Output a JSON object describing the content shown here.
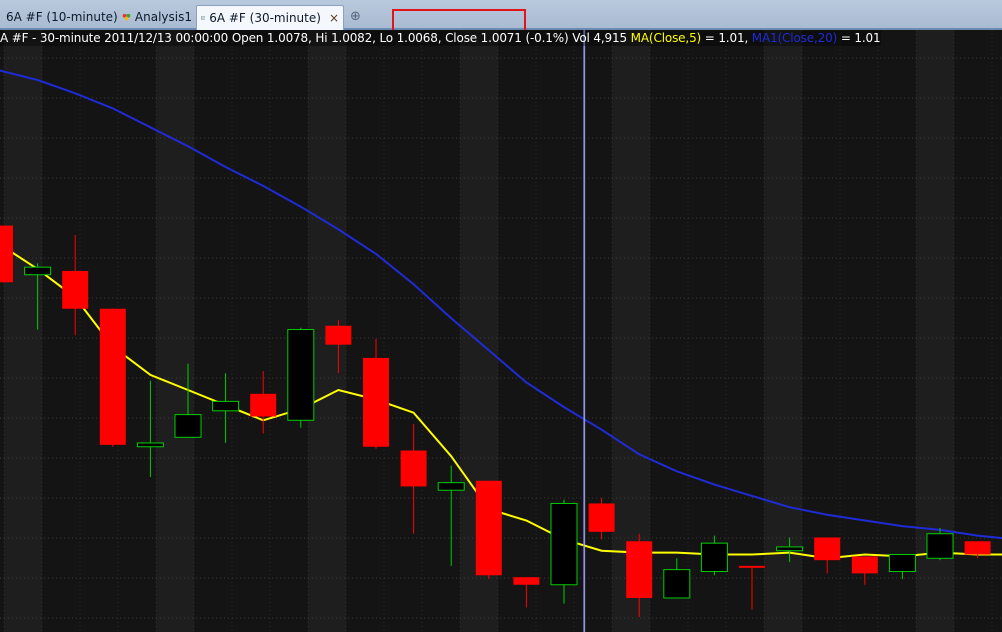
{
  "tabs": [
    {
      "label": "6A #F (10-minute)",
      "icon": "chart-icon",
      "active": false
    },
    {
      "label": "Analysis1",
      "icon": "analysis-icon",
      "active": false
    },
    {
      "label": "6A #F (30-minute)",
      "icon": "chart-icon",
      "active": true
    }
  ],
  "tab_close_symbol": "×",
  "new_tab_symbol": "⊕",
  "info": {
    "prefix": "A #F - 30-minute 2011/12/13 00:00:00 Open 1.0078, Hi 1.0082, Lo 1.0068, Close 1.0071 (-0.1%) Vol 4,915 ",
    "ma5_label": "MA(Close,5)",
    "ma5_value": " = 1.01, ",
    "ma20_label": "MA1(Close,20)",
    "ma20_value": " = 1.01"
  },
  "colors": {
    "up_candle": "#00cc00",
    "down_candle": "#ff0000",
    "ma5": "#ffff00",
    "ma20": "#1f2bd6",
    "crosshair": "#7b7bff",
    "highlight": "#e0161a"
  },
  "chart_data": {
    "type": "candlestick",
    "symbol": "6A #F",
    "interval": "30-minute",
    "candles": [
      {
        "o": 1.015,
        "h": 1.015,
        "l": 1.012,
        "c": 1.012,
        "dir": "down"
      },
      {
        "o": 1.0128,
        "h": 1.013,
        "l": 1.0095,
        "c": 1.0124,
        "dir": "up"
      },
      {
        "o": 1.0126,
        "h": 1.0145,
        "l": 1.0092,
        "c": 1.0106,
        "dir": "down"
      },
      {
        "o": 1.0106,
        "h": 1.0106,
        "l": 1.0033,
        "c": 1.0034,
        "dir": "down"
      },
      {
        "o": 1.0033,
        "h": 1.0068,
        "l": 1.0017,
        "c": 1.0035,
        "dir": "up"
      },
      {
        "o": 1.0038,
        "h": 1.0077,
        "l": 1.0038,
        "c": 1.005,
        "dir": "up"
      },
      {
        "o": 1.0052,
        "h": 1.0072,
        "l": 1.0035,
        "c": 1.0057,
        "dir": "up"
      },
      {
        "o": 1.0061,
        "h": 1.0073,
        "l": 1.004,
        "c": 1.0049,
        "dir": "down"
      },
      {
        "o": 1.0047,
        "h": 1.0096,
        "l": 1.0043,
        "c": 1.0095,
        "dir": "up"
      },
      {
        "o": 1.0097,
        "h": 1.01,
        "l": 1.0072,
        "c": 1.0087,
        "dir": "down"
      },
      {
        "o": 1.008,
        "h": 1.009,
        "l": 1.0032,
        "c": 1.0033,
        "dir": "down"
      },
      {
        "o": 1.0031,
        "h": 1.0045,
        "l": 0.9987,
        "c": 1.0012,
        "dir": "down"
      },
      {
        "o": 1.001,
        "h": 1.0023,
        "l": 0.997,
        "c": 1.0014,
        "dir": "up"
      },
      {
        "o": 1.0015,
        "h": 1.0015,
        "l": 0.9963,
        "c": 0.9965,
        "dir": "down"
      },
      {
        "o": 0.9964,
        "h": 0.9964,
        "l": 0.9948,
        "c": 0.996,
        "dir": "down"
      },
      {
        "o": 0.996,
        "h": 1.0005,
        "l": 0.995,
        "c": 1.0003,
        "dir": "up"
      },
      {
        "o": 1.0003,
        "h": 1.0006,
        "l": 0.9984,
        "c": 0.9988,
        "dir": "down"
      },
      {
        "o": 0.9983,
        "h": 0.9987,
        "l": 0.9943,
        "c": 0.9953,
        "dir": "down"
      },
      {
        "o": 0.9953,
        "h": 0.9974,
        "l": 0.9953,
        "c": 0.9968,
        "dir": "up"
      },
      {
        "o": 0.9967,
        "h": 0.9986,
        "l": 0.9965,
        "c": 0.9982,
        "dir": "up"
      },
      {
        "o": 0.997,
        "h": 0.997,
        "l": 0.9947,
        "c": 0.997,
        "dir": "down"
      },
      {
        "o": 0.9978,
        "h": 0.9985,
        "l": 0.9972,
        "c": 0.998,
        "dir": "up"
      },
      {
        "o": 0.9985,
        "h": 0.9985,
        "l": 0.9966,
        "c": 0.9973,
        "dir": "down"
      },
      {
        "o": 0.9975,
        "h": 0.9975,
        "l": 0.996,
        "c": 0.9966,
        "dir": "down"
      },
      {
        "o": 0.9967,
        "h": 0.9976,
        "l": 0.9963,
        "c": 0.9976,
        "dir": "up"
      },
      {
        "o": 0.9974,
        "h": 0.999,
        "l": 0.9973,
        "c": 0.9987,
        "dir": "up"
      },
      {
        "o": 0.9983,
        "h": 0.9983,
        "l": 0.9974,
        "c": 0.9976,
        "dir": "down"
      },
      {
        "o": 0.9976,
        "h": 0.9978,
        "l": 0.997,
        "c": 0.9974,
        "dir": "down"
      }
    ],
    "ma5": [
      1.014,
      1.0127,
      1.0112,
      1.0086,
      1.0071,
      1.0063,
      1.0055,
      1.0047,
      1.0053,
      1.0063,
      1.0058,
      1.0051,
      1.0028,
      1.0,
      0.9994,
      0.9984,
      0.9978,
      0.9977,
      0.9977,
      0.9976,
      0.9976,
      0.9977,
      0.9974,
      0.9976,
      0.9975,
      0.9977,
      0.9976,
      0.9976
    ],
    "ma20": [
      1.0232,
      1.0227,
      1.022,
      1.0212,
      1.0202,
      1.0192,
      1.0181,
      1.0171,
      1.016,
      1.0148,
      1.0135,
      1.0119,
      1.0101,
      1.0084,
      1.0067,
      1.0054,
      1.0042,
      1.0029,
      1.002,
      1.0013,
      1.0007,
      1.0001,
      0.9997,
      0.9994,
      0.9991,
      0.9989,
      0.9986,
      0.9984
    ],
    "ylim": [
      0.9935,
      1.0245
    ],
    "crosshair_index": 15.5
  }
}
